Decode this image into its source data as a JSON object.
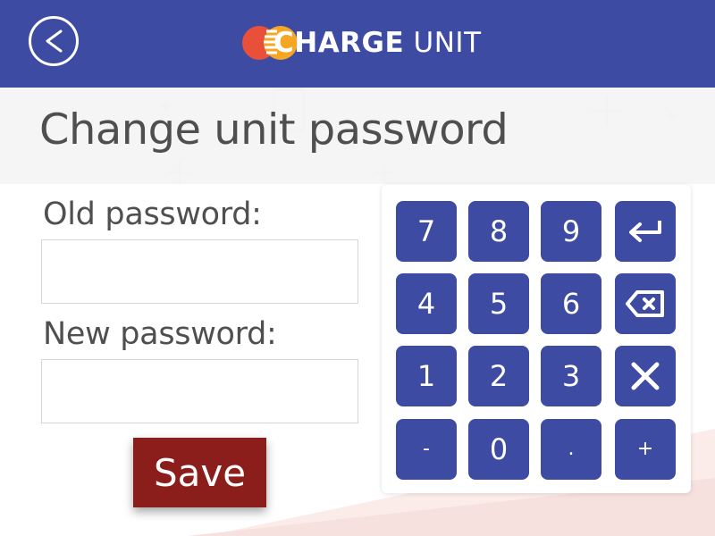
{
  "header": {
    "back_icon": "chevron-left-icon",
    "brand_bold": "CHARGE",
    "brand_light": "UNIT",
    "brand_colors": {
      "bar": "#3d4ba3",
      "logo_red": "#e8503a",
      "logo_orange": "#f5a623"
    }
  },
  "page": {
    "title": "Change unit password"
  },
  "form": {
    "old_password_label": "Old password:",
    "old_password_value": "",
    "new_password_label": "New password:",
    "new_password_value": "",
    "save_label": "Save",
    "save_color": "#8b1e1b"
  },
  "keypad": {
    "rows": [
      [
        {
          "label": "7"
        },
        {
          "label": "8"
        },
        {
          "label": "9"
        },
        {
          "label": "",
          "icon": "enter-icon"
        }
      ],
      [
        {
          "label": "4"
        },
        {
          "label": "5"
        },
        {
          "label": "6"
        },
        {
          "label": "",
          "icon": "backspace-icon"
        }
      ],
      [
        {
          "label": "1"
        },
        {
          "label": "2"
        },
        {
          "label": "3"
        },
        {
          "label": "",
          "icon": "close-icon"
        }
      ],
      [
        {
          "label": "-"
        },
        {
          "label": "0"
        },
        {
          "label": "."
        },
        {
          "label": "+"
        }
      ]
    ]
  }
}
